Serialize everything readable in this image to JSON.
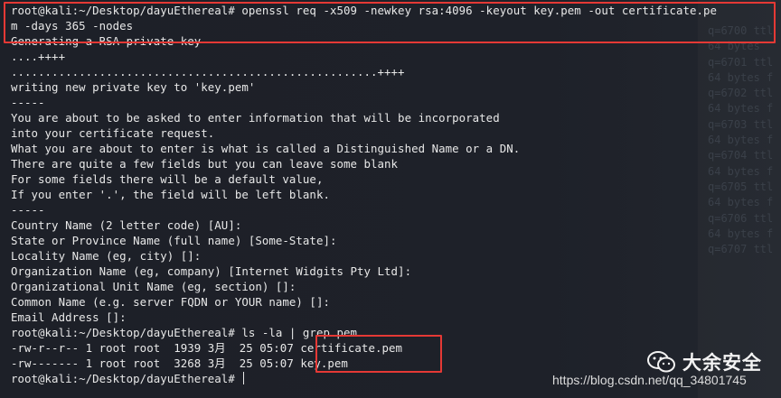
{
  "terminal": {
    "lines": [
      "root@kali:~/Desktop/dayuEthereal# openssl req -x509 -newkey rsa:4096 -keyout key.pem -out certificate.pe",
      "m -days 365 -nodes",
      "Generating a RSA private key",
      "....++++",
      "......................................................++++",
      "writing new private key to 'key.pem'",
      "-----",
      "You are about to be asked to enter information that will be incorporated",
      "into your certificate request.",
      "What you are about to enter is what is called a Distinguished Name or a DN.",
      "There are quite a few fields but you can leave some blank",
      "For some fields there will be a default value,",
      "If you enter '.', the field will be left blank.",
      "-----",
      "Country Name (2 letter code) [AU]:",
      "State or Province Name (full name) [Some-State]:",
      "Locality Name (eg, city) []:",
      "Organization Name (eg, company) [Internet Widgits Pty Ltd]:",
      "Organizational Unit Name (eg, section) []:",
      "Common Name (e.g. server FQDN or YOUR name) []:",
      "Email Address []:",
      "root@kali:~/Desktop/dayuEthereal# ls -la | grep pem",
      "-rw-r--r-- 1 root root  1939 3月  25 05:07 certificate.pem",
      "-rw------- 1 root root  3268 3月  25 05:07 key.pem",
      "root@kali:~/Desktop/dayuEthereal# "
    ],
    "background_lines": [
      "q=6700 ttl",
      "64 bytes",
      "q=6701 ttl",
      "64 bytes f",
      "q=6702 ttl",
      "64 bytes f",
      "q=6703 ttl",
      "64 bytes f",
      "q=6704 ttl",
      "64 bytes f",
      "q=6705 ttl",
      "64 bytes f",
      "q=6706 ttl",
      "64 bytes f",
      "q=6707 ttl"
    ]
  },
  "watermark": {
    "name": "大余安全",
    "url": "https://blog.csdn.net/qq_34801745",
    "icon": "wechat-icon"
  },
  "colors": {
    "background": "#1d2028",
    "text": "#e8e8e8",
    "highlight_box": "#e53935"
  }
}
